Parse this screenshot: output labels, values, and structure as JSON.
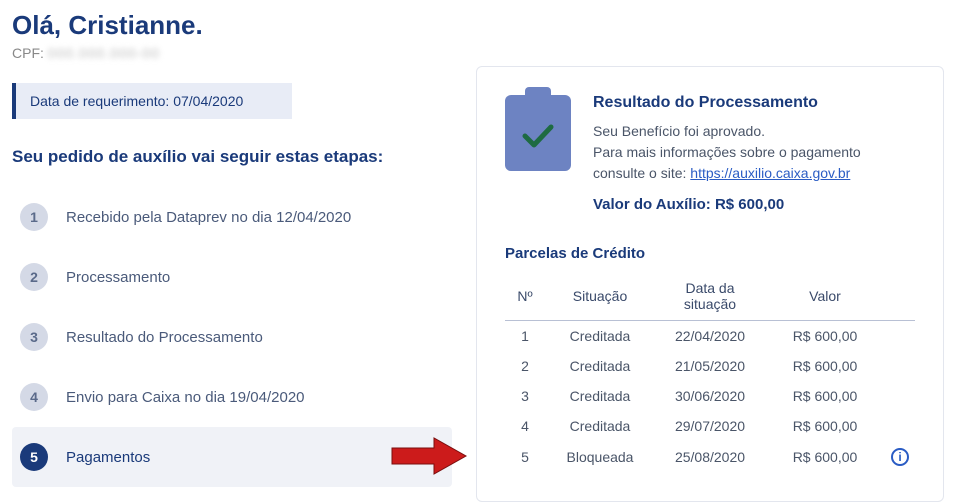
{
  "header": {
    "greeting": "Olá, Cristianne.",
    "cpf_label": "CPF:",
    "cpf_value": "000.000.000-00",
    "request_date_label": "Data de requerimento:",
    "request_date_value": " 07/04/2020"
  },
  "steps": {
    "heading": "Seu pedido de auxílio vai seguir estas etapas:",
    "items": [
      {
        "num": "1",
        "label": "Recebido pela Dataprev no dia 12/04/2020",
        "active": false
      },
      {
        "num": "2",
        "label": "Processamento",
        "active": false
      },
      {
        "num": "3",
        "label": "Resultado do Processamento",
        "active": false
      },
      {
        "num": "4",
        "label": "Envio para Caixa no dia 19/04/2020",
        "active": false
      },
      {
        "num": "5",
        "label": "Pagamentos",
        "active": true
      }
    ]
  },
  "result": {
    "title": "Resultado do Processamento",
    "approved_text": "Seu Benefício foi aprovado.",
    "more_info_text": "Para mais informações sobre o pagamento consulte o site: ",
    "link_text": "https://auxilio.caixa.gov.br",
    "amount_label": "Valor do Auxílio: ",
    "amount_value": "R$ 600,00"
  },
  "parcelas": {
    "title": "Parcelas de Crédito",
    "columns": {
      "num": "Nº",
      "status": "Situação",
      "date": "Data da situação",
      "value": "Valor"
    },
    "rows": [
      {
        "num": "1",
        "status": "Creditada",
        "date": "22/04/2020",
        "value": "R$ 600,00",
        "info": false
      },
      {
        "num": "2",
        "status": "Creditada",
        "date": "21/05/2020",
        "value": "R$ 600,00",
        "info": false
      },
      {
        "num": "3",
        "status": "Creditada",
        "date": "30/06/2020",
        "value": "R$ 600,00",
        "info": false
      },
      {
        "num": "4",
        "status": "Creditada",
        "date": "29/07/2020",
        "value": "R$ 600,00",
        "info": false
      },
      {
        "num": "5",
        "status": "Bloqueada",
        "date": "25/08/2020",
        "value": "R$ 600,00",
        "info": true
      }
    ]
  },
  "colors": {
    "primary": "#1a3a7a",
    "link": "#2a5cc4",
    "arrow": "#cc1b1b"
  }
}
